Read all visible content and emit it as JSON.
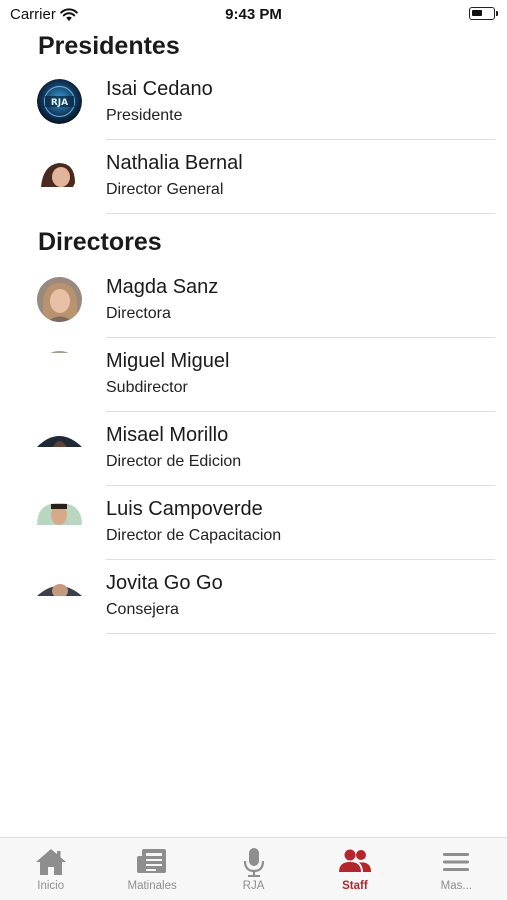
{
  "status_bar": {
    "carrier": "Carrier",
    "time": "9:43 PM",
    "battery_level": 0.55
  },
  "sections": [
    {
      "title": "Presidentes",
      "members": [
        {
          "name": "Isai Cedano",
          "role": "Presidente",
          "avatar": "rja-logo"
        },
        {
          "name": "Nathalia Bernal",
          "role": "Director General",
          "avatar": "photo"
        }
      ]
    },
    {
      "title": "Directores",
      "members": [
        {
          "name": "Magda Sanz",
          "role": "Directora",
          "avatar": "photo"
        },
        {
          "name": "Miguel Miguel",
          "role": "Subdirector",
          "avatar": "photo"
        },
        {
          "name": "Misael Morillo",
          "role": "Director de Edicion",
          "avatar": "photo"
        },
        {
          "name": "Luis Campoverde",
          "role": "Director de Capacitacion",
          "avatar": "photo"
        },
        {
          "name": "Jovita Go Go",
          "role": "Consejera",
          "avatar": "photo"
        }
      ]
    }
  ],
  "tab_bar": {
    "active_color": "#b3262b",
    "inactive_color": "#8e8e8e",
    "tabs": [
      {
        "label": "Inicio",
        "icon": "home-icon",
        "active": false
      },
      {
        "label": "Matinales",
        "icon": "newspaper-icon",
        "active": false
      },
      {
        "label": "RJA",
        "icon": "microphone-icon",
        "active": false
      },
      {
        "label": "Staff",
        "icon": "users-icon",
        "active": true
      },
      {
        "label": "Mas...",
        "icon": "menu-icon",
        "active": false
      }
    ]
  }
}
